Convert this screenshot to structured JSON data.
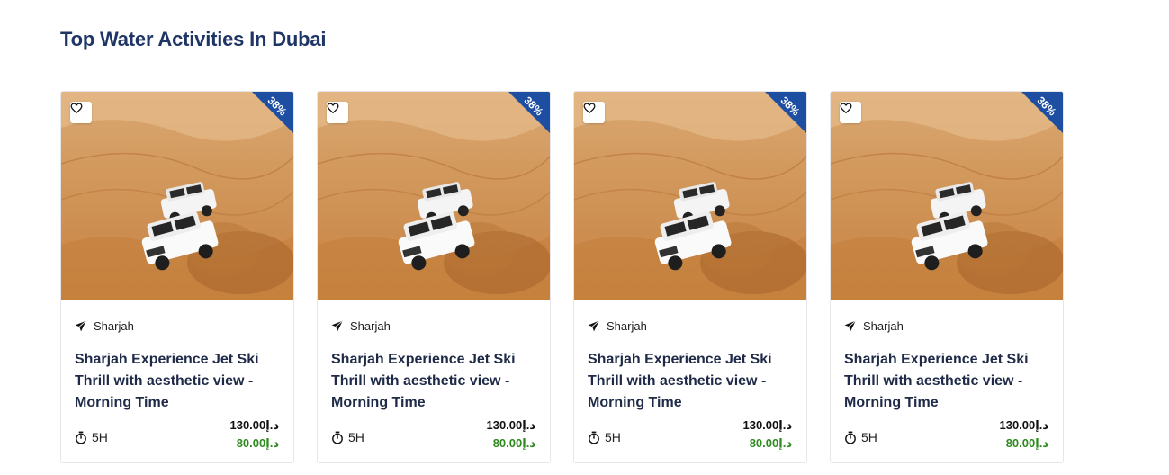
{
  "section": {
    "title": "Top Water Activities In Dubai"
  },
  "colors": {
    "ribbon": "#1d4ea2",
    "title": "#1f3566",
    "new_price": "#2e8b1e"
  },
  "cards": [
    {
      "discount": "38%",
      "location": "Sharjah",
      "title": "Sharjah Experience Jet Ski Thrill with aesthetic view - Morning Time",
      "duration": "5H",
      "old_price": "130.00د.إ",
      "new_price": "80.00د.إ"
    },
    {
      "discount": "38%",
      "location": "Sharjah",
      "title": "Sharjah Experience Jet Ski Thrill with aesthetic view - Morning Time",
      "duration": "5H",
      "old_price": "130.00د.إ",
      "new_price": "80.00د.إ"
    },
    {
      "discount": "38%",
      "location": "Sharjah",
      "title": "Sharjah Experience Jet Ski Thrill with aesthetic view - Morning Time",
      "duration": "5H",
      "old_price": "130.00د.إ",
      "new_price": "80.00د.إ"
    },
    {
      "discount": "38%",
      "location": "Sharjah",
      "title": "Sharjah Experience Jet Ski Thrill with aesthetic view - Morning Time",
      "duration": "5H",
      "old_price": "130.00د.إ",
      "new_price": "80.00د.إ"
    }
  ],
  "icons": {
    "wishlist": "heart-icon",
    "location": "send-icon",
    "duration": "stopwatch-icon"
  }
}
